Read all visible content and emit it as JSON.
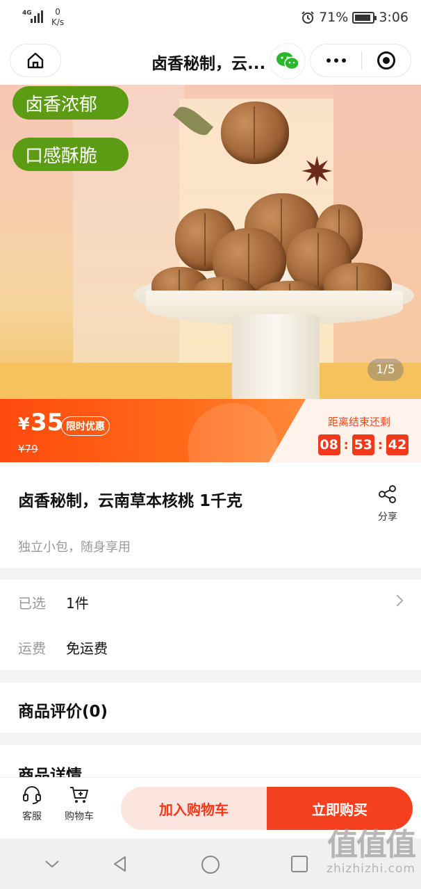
{
  "status_bar": {
    "signal_label": "4G",
    "net_speed_value": "0",
    "net_speed_unit": "K/s",
    "battery_percent": "71%",
    "time": "3:06"
  },
  "nav": {
    "title": "卤香秘制，云..."
  },
  "hero": {
    "tags": [
      "卤香浓郁",
      "口感酥脆"
    ],
    "pager": "1/5"
  },
  "price": {
    "currency": "¥",
    "current": "35",
    "badge": "限时优惠",
    "original": "¥79",
    "countdown_label": "距离结束还剩",
    "countdown": {
      "hours": "08",
      "minutes": "53",
      "seconds": "42"
    }
  },
  "product": {
    "title": "卤香秘制，云南草本核桃 1千克",
    "subtitle": "独立小包，随身享用",
    "share_label": "分享"
  },
  "options": {
    "selected_label": "已选",
    "selected_value": "1件",
    "shipping_label": "运费",
    "shipping_value": "免运费"
  },
  "sections": {
    "reviews": "商品评价(0)",
    "details": "商品详情"
  },
  "action_bar": {
    "service_label": "客服",
    "cart_label": "购物车",
    "add_to_cart": "加入购物车",
    "buy_now": "立即购买"
  },
  "watermark": {
    "glyphs": "值值值",
    "text": "zhizhizhi.com"
  },
  "colors": {
    "accent": "#f4401f",
    "tag_green": "#5c9b14"
  }
}
